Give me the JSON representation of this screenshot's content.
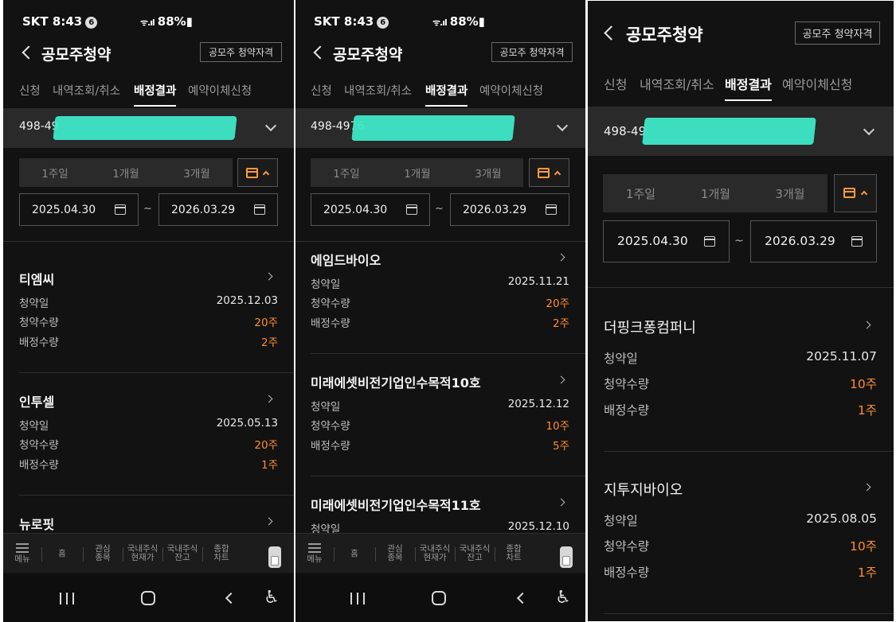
{
  "status": {
    "carrier": "SKT 8:43",
    "badge": "6",
    "signal": "ᯤ.ıl",
    "battery": "88%▮"
  },
  "header": {
    "title": "공모주청약",
    "qual_button": "공모주 청약자격"
  },
  "tabs": [
    "신청",
    "내역조회/취소",
    "배정결과",
    "예약이체신청"
  ],
  "active_tab": "배정결과",
  "account": {
    "visible_prefix_1": "498-49",
    "visible_prefix_2": "498-4976",
    "visible_prefix_3": "498-49"
  },
  "period": {
    "w1": "1주일",
    "m1": "1개월",
    "m3": "3개월"
  },
  "date_range": {
    "from": "2025.04.30",
    "to": "2026.03.29",
    "tilde": "~"
  },
  "labels": {
    "subscribe_date": "청약일",
    "subscribe_qty": "청약수량",
    "allot_qty": "배정수량"
  },
  "panels": {
    "p1": [
      {
        "name": "티엠씨",
        "date": "2025.12.03",
        "qty": "20주",
        "allot": "2주"
      },
      {
        "name": "인투셀",
        "date": "2025.05.13",
        "qty": "20주",
        "allot": "1주"
      },
      {
        "name": "뉴로핏"
      }
    ],
    "p2": [
      {
        "name": "에임드바이오",
        "date": "2025.11.21",
        "qty": "20주",
        "allot": "2주"
      },
      {
        "name": "미래에셋비전기업인수목적10호",
        "date": "2025.12.12",
        "qty": "10주",
        "allot": "5주"
      },
      {
        "name": "미래에셋비전기업인수목적11호",
        "date": "2025.12.10"
      }
    ],
    "p3": [
      {
        "name": "더핑크퐁컴퍼니",
        "date": "2025.11.07",
        "qty": "10주",
        "allot": "1주"
      },
      {
        "name": "지투지바이오",
        "date": "2025.08.05",
        "qty": "10주",
        "allot": "1주"
      }
    ]
  },
  "bottom_nav": {
    "menu": "메뉴",
    "home": "홈",
    "watch": [
      "관심",
      "종목"
    ],
    "price": [
      "국내주식",
      "현재가"
    ],
    "balance": [
      "국내주식",
      "잔고"
    ],
    "chart": [
      "종합",
      "차트"
    ]
  },
  "colors": {
    "bg": "#121212",
    "accent": "#ff8c2e",
    "mask": "#3ee8c8"
  }
}
